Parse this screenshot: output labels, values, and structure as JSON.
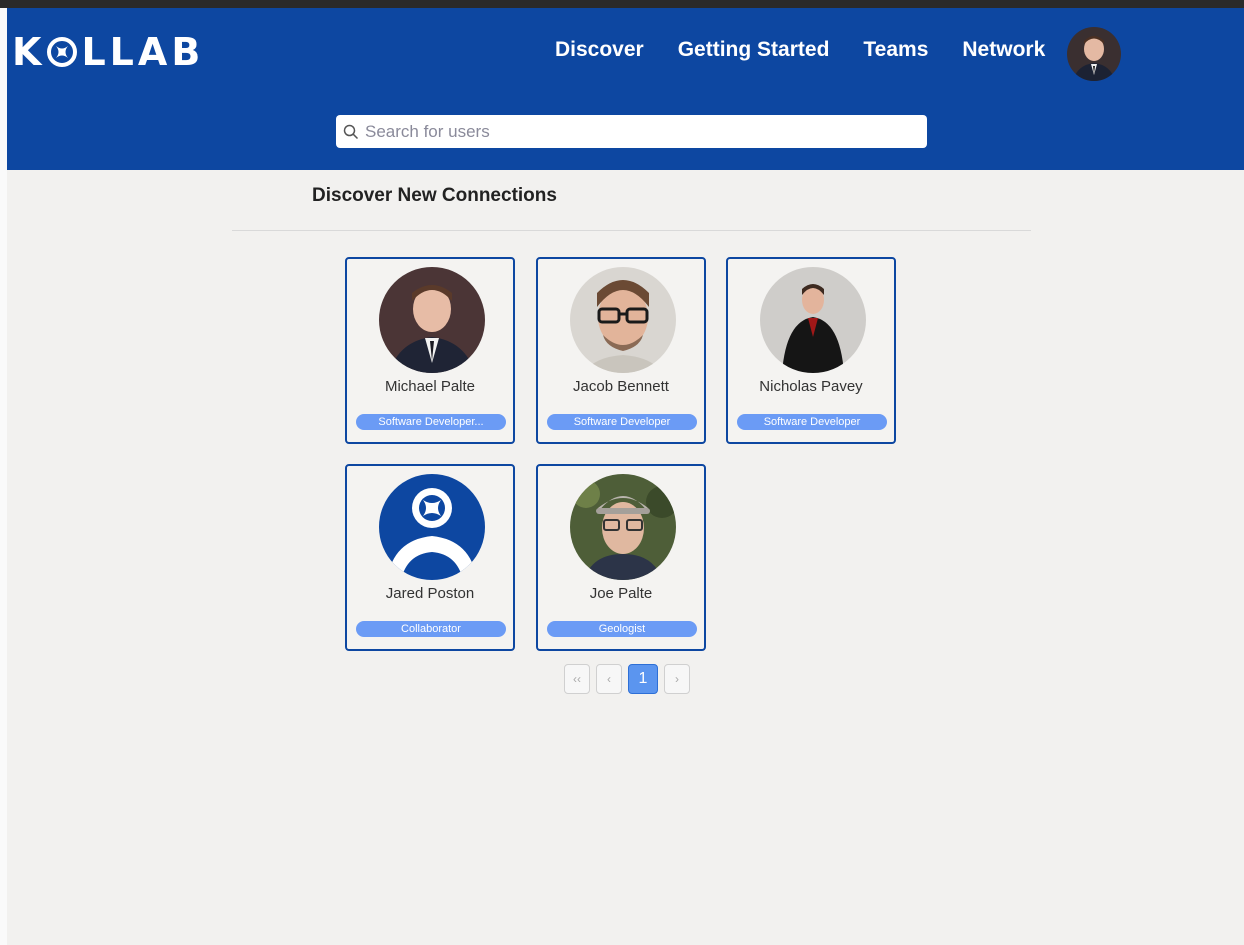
{
  "header": {
    "logo_letters": [
      "K",
      "L",
      "L",
      "A",
      "B"
    ],
    "logo_text": "KOLLAB",
    "nav": [
      "Discover",
      "Getting Started",
      "Teams",
      "Network"
    ],
    "brand_color": "#0d47a1"
  },
  "search": {
    "placeholder": "Search for users",
    "value": ""
  },
  "main": {
    "title": "Discover New Connections",
    "cards": [
      {
        "name": "Michael Palte",
        "role": "Software Developer..."
      },
      {
        "name": "Jacob Bennett",
        "role": "Software Developer"
      },
      {
        "name": "Nicholas Pavey",
        "role": "Software Developer"
      },
      {
        "name": "Jared Poston",
        "role": "Collaborator"
      },
      {
        "name": "Joe Palte",
        "role": "Geologist"
      }
    ],
    "badge_color": "#6b9bf5"
  },
  "pagination": {
    "first": "‹‹",
    "prev": "‹",
    "current": "1",
    "next": "›"
  }
}
